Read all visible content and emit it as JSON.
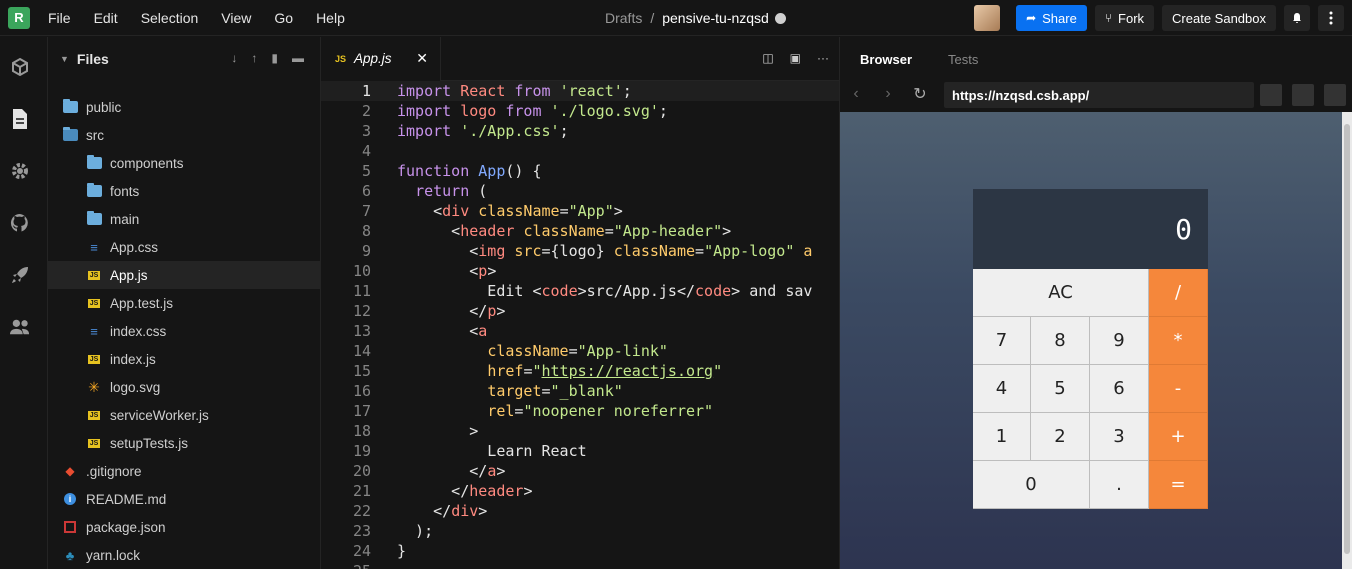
{
  "topbar": {
    "logo_letter": "R",
    "menu": [
      "File",
      "Edit",
      "Selection",
      "View",
      "Go",
      "Help"
    ],
    "breadcrumb_root": "Drafts",
    "breadcrumb_sep": "/",
    "sandbox_name": "pensive-tu-nzqsd",
    "share_label": "Share",
    "fork_label": "Fork",
    "create_label": "Create Sandbox"
  },
  "sidebar": {
    "title": "Files",
    "items": [
      {
        "label": "public",
        "icon": "folder-icon"
      },
      {
        "label": "src",
        "icon": "folder-open-icon"
      },
      {
        "label": "components",
        "icon": "folder-icon"
      },
      {
        "label": "fonts",
        "icon": "folder-icon"
      },
      {
        "label": "main",
        "icon": "folder-icon"
      },
      {
        "label": "App.css",
        "icon": "css-file-icon"
      },
      {
        "label": "App.js",
        "icon": "js-file-icon"
      },
      {
        "label": "App.test.js",
        "icon": "js-file-icon"
      },
      {
        "label": "index.css",
        "icon": "css-file-icon"
      },
      {
        "label": "index.js",
        "icon": "js-file-icon"
      },
      {
        "label": "logo.svg",
        "icon": "svg-file-icon"
      },
      {
        "label": "serviceWorker.js",
        "icon": "js-file-icon"
      },
      {
        "label": "setupTests.js",
        "icon": "js-file-icon"
      },
      {
        "label": ".gitignore",
        "icon": "git-icon"
      },
      {
        "label": "README.md",
        "icon": "info-icon"
      },
      {
        "label": "package.json",
        "icon": "npm-icon"
      },
      {
        "label": "yarn.lock",
        "icon": "yarn-icon"
      }
    ]
  },
  "editor": {
    "tab_label": "App.js",
    "tab_badge": "JS",
    "current_line": 1
  },
  "browser": {
    "tabs": [
      "Browser",
      "Tests"
    ],
    "url": "https://nzqsd.csb.app/"
  },
  "calculator": {
    "display": "0",
    "keys": [
      "AC",
      "/",
      "7",
      "8",
      "9",
      "*",
      "4",
      "5",
      "6",
      "-",
      "1",
      "2",
      "3",
      "+",
      "0",
      ".",
      "="
    ]
  },
  "colors": {
    "accent": "#0971f1",
    "operator": "#f5873b",
    "logo": "#3ba55c"
  }
}
